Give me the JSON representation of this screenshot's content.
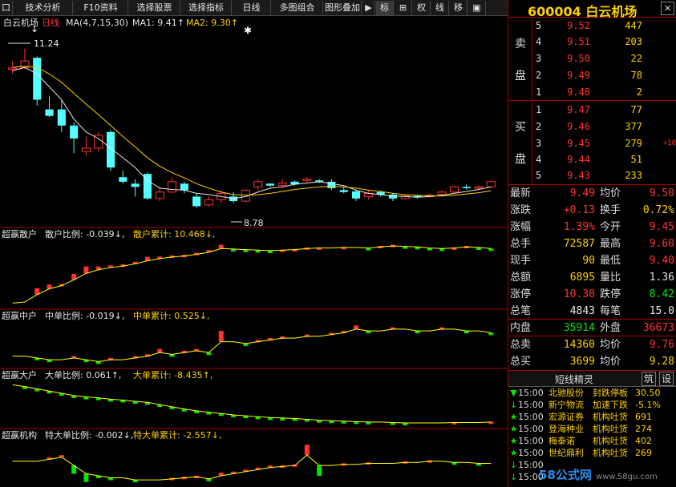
{
  "toolbar": {
    "items": [
      {
        "label": "口"
      },
      {
        "label": "技术分析"
      },
      {
        "label": "F10资料"
      },
      {
        "label": "选择股票"
      },
      {
        "label": "选择指标"
      },
      {
        "label": "日线"
      },
      {
        "label": "多图组合"
      },
      {
        "label": "图形叠加"
      },
      {
        "label": "▶"
      },
      {
        "label": "标"
      },
      {
        "label": "⊞"
      },
      {
        "label": "权"
      },
      {
        "label": "线"
      },
      {
        "label": "移"
      },
      {
        "label": "▣"
      }
    ]
  },
  "main_chart": {
    "title": "白云机场",
    "period": "日线",
    "ma_desc": "MA(4,7,15,30)",
    "ma1": "MA1: 9.41↑",
    "ma2": "MA2: 9.30↑",
    "high_mark": "11.24",
    "low_mark": "8.78"
  },
  "indicators": [
    {
      "name": "超赢散户",
      "ratio": "散户比例: -0.039↓,",
      "cum": "散户累计: 10.468↓,"
    },
    {
      "name": "超赢中户",
      "ratio": "中单比例: -0.019↓,",
      "cum": "中单累计: 0.525↓,"
    },
    {
      "name": "超赢大户",
      "ratio": "大单比例: 0.061↑,",
      "cum": "大单累计: -8.435↑,"
    },
    {
      "name": "超赢机构",
      "ratio": "特大单比例: -0.002↓,",
      "cum": "特大单累计: -2.557↓,"
    }
  ],
  "stock": {
    "code": "600004",
    "name": "白云机场",
    "close_icon": "✕"
  },
  "order_book": {
    "sell_side": [
      "卖",
      "盘"
    ],
    "buy_side": [
      "买",
      "盘"
    ],
    "sell": [
      {
        "level": "5",
        "price": "9.52",
        "vol": "447"
      },
      {
        "level": "4",
        "price": "9.51",
        "vol": "203"
      },
      {
        "level": "3",
        "price": "9.50",
        "vol": "22"
      },
      {
        "level": "2",
        "price": "9.49",
        "vol": "78"
      },
      {
        "level": "1",
        "price": "9.48",
        "vol": "2"
      }
    ],
    "buy": [
      {
        "level": "1",
        "price": "9.47",
        "vol": "77",
        "chg": ""
      },
      {
        "level": "2",
        "price": "9.46",
        "vol": "377",
        "chg": ""
      },
      {
        "level": "3",
        "price": "9.45",
        "vol": "279",
        "chg": "+10"
      },
      {
        "level": "4",
        "price": "9.44",
        "vol": "51",
        "chg": ""
      },
      {
        "level": "5",
        "price": "9.43",
        "vol": "233",
        "chg": ""
      }
    ]
  },
  "quote": [
    {
      "k1": "最新",
      "v1": "9.49",
      "c1": "red",
      "k2": "均价",
      "v2": "9.50",
      "c2": "red"
    },
    {
      "k1": "涨跌",
      "v1": "+0.13",
      "c1": "red",
      "k2": "换手",
      "v2": "0.72%",
      "c2": "yellow"
    },
    {
      "k1": "涨幅",
      "v1": "1.39%",
      "c1": "red",
      "k2": "今开",
      "v2": "9.45",
      "c2": "red"
    },
    {
      "k1": "总手",
      "v1": "72587",
      "c1": "yellow",
      "k2": "最高",
      "v2": "9.60",
      "c2": "red"
    },
    {
      "k1": "现手",
      "v1": "90",
      "c1": "yellow",
      "k2": "最低",
      "v2": "9.40",
      "c2": "red"
    },
    {
      "k1": "总额",
      "v1": "6895",
      "c1": "yellow",
      "k2": "量比",
      "v2": "1.36",
      "c2": "white"
    },
    {
      "k1": "涨停",
      "v1": "10.30",
      "c1": "red",
      "k2": "跌停",
      "v2": "8.42",
      "c2": "green"
    },
    {
      "k1": "总笔",
      "v1": "4843",
      "c1": "white",
      "k2": "每笔",
      "v2": "15.0",
      "c2": "white"
    },
    {
      "k1": "内盘",
      "v1": "35914",
      "c1": "green",
      "k2": "外盘",
      "v2": "36673",
      "c2": "red"
    },
    {
      "k1": "总卖",
      "v1": "14360",
      "c1": "yellow",
      "k2": "均价",
      "v2": "9.76",
      "c2": "red"
    },
    {
      "k1": "总买",
      "v1": "3699",
      "c1": "yellow",
      "k2": "均价",
      "v2": "9.28",
      "c2": "yellow"
    }
  ],
  "elf": {
    "title": "短线精灵",
    "btn1": "筑",
    "btn2": "设",
    "rows": [
      {
        "icon": "▼",
        "icolor": "#00e600",
        "time": "15:00",
        "name": "北驰股份",
        "event": "封跌停板",
        "value": "30.50"
      },
      {
        "icon": "↓",
        "icolor": "#00e600",
        "time": "15:00",
        "name": "新宁物流",
        "event": "加速下跌",
        "value": "-5.1%"
      },
      {
        "icon": "★",
        "icolor": "#00e600",
        "time": "15:00",
        "name": "宏源证券",
        "event": "机构吐货",
        "value": "691"
      },
      {
        "icon": "★",
        "icolor": "#00e600",
        "time": "15:00",
        "name": "登海种业",
        "event": "机构吐货",
        "value": "274"
      },
      {
        "icon": "★",
        "icolor": "#00e600",
        "time": "15:00",
        "name": "梅泰诺",
        "event": "机构吐货",
        "value": "402"
      },
      {
        "icon": "★",
        "icolor": "#00e600",
        "time": "15:00",
        "name": "世纪鼎利",
        "event": "机构吐货",
        "value": "269"
      },
      {
        "icon": "↓",
        "icolor": "#00e600",
        "time": "15:00",
        "name": "",
        "event": "",
        "value": ""
      },
      {
        "icon": "↓",
        "icolor": "#00e600",
        "time": "15:00",
        "name": "",
        "event": "",
        "value": ""
      }
    ]
  },
  "watermark": {
    "brand": "58公式网",
    "url": "www.58gu.com"
  },
  "colors": {
    "up": "#ff3232",
    "down": "#54ffff",
    "ma1": "#e6e6e6",
    "ma2": "#ffd000",
    "green": "#00e600",
    "border": "#aa0000"
  },
  "chart_data": {
    "type": "candlestick",
    "title": "白云机场 日线",
    "candles": [
      {
        "o": 10.92,
        "h": 11.05,
        "l": 10.85,
        "c": 10.94
      },
      {
        "o": 10.95,
        "h": 11.24,
        "l": 10.92,
        "c": 11.05
      },
      {
        "o": 11.1,
        "h": 11.12,
        "l": 10.36,
        "c": 10.45
      },
      {
        "o": 10.3,
        "h": 10.5,
        "l": 10.18,
        "c": 10.2
      },
      {
        "o": 10.3,
        "h": 10.45,
        "l": 9.95,
        "c": 10.05
      },
      {
        "o": 10.05,
        "h": 10.1,
        "l": 9.62,
        "c": 9.85
      },
      {
        "o": 9.65,
        "h": 9.88,
        "l": 9.58,
        "c": 9.7
      },
      {
        "o": 9.7,
        "h": 9.95,
        "l": 9.65,
        "c": 9.9
      },
      {
        "o": 9.95,
        "h": 9.98,
        "l": 9.35,
        "c": 9.4
      },
      {
        "o": 9.25,
        "h": 9.35,
        "l": 9.15,
        "c": 9.18
      },
      {
        "o": 9.15,
        "h": 9.22,
        "l": 8.95,
        "c": 9.1
      },
      {
        "o": 9.3,
        "h": 9.32,
        "l": 8.9,
        "c": 8.92
      },
      {
        "o": 8.92,
        "h": 9.1,
        "l": 8.88,
        "c": 9.02
      },
      {
        "o": 9.02,
        "h": 9.25,
        "l": 9.0,
        "c": 9.18
      },
      {
        "o": 9.15,
        "h": 9.18,
        "l": 9.0,
        "c": 9.05
      },
      {
        "o": 8.95,
        "h": 9.0,
        "l": 8.78,
        "c": 8.8
      },
      {
        "o": 8.82,
        "h": 8.95,
        "l": 8.8,
        "c": 8.9
      },
      {
        "o": 8.9,
        "h": 9.05,
        "l": 8.85,
        "c": 9.0
      },
      {
        "o": 8.95,
        "h": 9.02,
        "l": 8.85,
        "c": 8.88
      },
      {
        "o": 8.88,
        "h": 9.05,
        "l": 8.86,
        "c": 9.05
      },
      {
        "o": 9.1,
        "h": 9.22,
        "l": 9.05,
        "c": 9.18
      },
      {
        "o": 9.15,
        "h": 9.16,
        "l": 9.1,
        "c": 9.12
      },
      {
        "o": 9.12,
        "h": 9.22,
        "l": 9.08,
        "c": 9.16
      },
      {
        "o": 9.18,
        "h": 9.2,
        "l": 9.12,
        "c": 9.14
      },
      {
        "o": 9.2,
        "h": 9.25,
        "l": 9.15,
        "c": 9.22
      },
      {
        "o": 9.2,
        "h": 9.22,
        "l": 9.16,
        "c": 9.18
      },
      {
        "o": 9.18,
        "h": 9.22,
        "l": 9.05,
        "c": 9.08
      },
      {
        "o": 9.05,
        "h": 9.1,
        "l": 9.0,
        "c": 9.02
      },
      {
        "o": 9.03,
        "h": 9.06,
        "l": 8.88,
        "c": 8.92
      },
      {
        "o": 8.95,
        "h": 9.05,
        "l": 8.9,
        "c": 9.0
      },
      {
        "o": 9.02,
        "h": 9.04,
        "l": 8.95,
        "c": 8.98
      },
      {
        "o": 8.98,
        "h": 9.0,
        "l": 8.88,
        "c": 8.92
      },
      {
        "o": 8.92,
        "h": 8.98,
        "l": 8.9,
        "c": 8.96
      },
      {
        "o": 8.96,
        "h": 8.98,
        "l": 8.92,
        "c": 8.94
      },
      {
        "o": 8.95,
        "h": 9.0,
        "l": 8.93,
        "c": 8.97
      },
      {
        "o": 8.98,
        "h": 9.05,
        "l": 8.95,
        "c": 9.02
      },
      {
        "o": 9.02,
        "h": 9.12,
        "l": 9.0,
        "c": 9.1
      },
      {
        "o": 9.1,
        "h": 9.14,
        "l": 9.06,
        "c": 9.08
      },
      {
        "o": 9.08,
        "h": 9.12,
        "l": 9.05,
        "c": 9.1
      },
      {
        "o": 9.1,
        "h": 9.2,
        "l": 9.08,
        "c": 9.18
      }
    ],
    "ma1": [
      10.9,
      10.95,
      10.85,
      10.65,
      10.45,
      10.15,
      9.95,
      9.85,
      9.7,
      9.55,
      9.4,
      9.2,
      9.08,
      9.06,
      9.05,
      9.0,
      8.98,
      8.95,
      8.92,
      8.95,
      9.02,
      9.08,
      9.1,
      9.14,
      9.16,
      9.18,
      9.15,
      9.12,
      9.05,
      9.0,
      8.98,
      8.96,
      8.95,
      8.94,
      8.95,
      8.97,
      9.0,
      9.03,
      9.06,
      9.1
    ],
    "ma2": [
      10.95,
      10.97,
      10.95,
      10.85,
      10.72,
      10.55,
      10.38,
      10.22,
      10.05,
      9.88,
      9.72,
      9.55,
      9.42,
      9.32,
      9.24,
      9.15,
      9.08,
      9.02,
      8.98,
      8.97,
      8.98,
      9.0,
      9.03,
      9.06,
      9.08,
      9.1,
      9.11,
      9.1,
      9.08,
      9.05,
      9.03,
      9.0,
      8.98,
      8.97,
      8.96,
      8.96,
      8.97,
      8.99,
      9.01,
      9.04
    ],
    "indicators": [
      {
        "name": "超赢散户",
        "line": [
          0.2,
          0.4,
          1.8,
          2.9,
          3.5,
          4.6,
          5.8,
          6.5,
          6.9,
          7.2,
          7.6,
          8.2,
          8.6,
          8.9,
          9.1,
          9.4,
          9.8,
          10.5,
          10.4,
          10.3,
          10.2,
          10.1,
          10.2,
          10.3,
          10.5,
          10.6,
          10.6,
          10.7,
          10.7,
          10.6,
          10.8,
          11.0,
          10.9,
          10.8,
          10.6,
          10.5,
          10.6,
          10.8,
          10.7,
          10.5
        ],
        "bars": [
          0.0,
          0.0,
          1.2,
          0.8,
          0.3,
          1.1,
          1.3,
          0.6,
          0.4,
          0.3,
          0.4,
          0.7,
          0.4,
          0.3,
          0.2,
          0.3,
          0.4,
          0.7,
          -0.1,
          -0.1,
          -0.1,
          -0.1,
          0.1,
          0.1,
          0.2,
          0.1,
          0.0,
          0.1,
          0.0,
          -0.1,
          0.2,
          0.2,
          -0.1,
          -0.1,
          -0.2,
          -0.1,
          0.1,
          0.2,
          -0.1,
          -0.2
        ]
      },
      {
        "name": "超赢中户",
        "line": [
          -0.2,
          -0.2,
          -0.25,
          -0.3,
          -0.3,
          -0.25,
          -0.3,
          -0.35,
          -0.3,
          -0.3,
          -0.25,
          -0.2,
          -0.1,
          -0.15,
          -0.1,
          -0.05,
          -0.1,
          0.2,
          0.2,
          0.15,
          0.2,
          0.25,
          0.3,
          0.3,
          0.35,
          0.35,
          0.4,
          0.45,
          0.55,
          0.5,
          0.5,
          0.55,
          0.55,
          0.5,
          0.5,
          0.55,
          0.55,
          0.5,
          0.5,
          0.45
        ],
        "bars": [
          0.0,
          0.0,
          -0.05,
          -0.05,
          0.0,
          0.05,
          -0.05,
          -0.05,
          0.05,
          0.0,
          0.05,
          0.05,
          0.1,
          -0.05,
          0.05,
          0.05,
          -0.05,
          0.3,
          0.0,
          -0.05,
          0.05,
          0.05,
          0.05,
          0.0,
          0.05,
          0.0,
          0.05,
          0.05,
          0.1,
          -0.05,
          0.0,
          0.05,
          0.0,
          -0.05,
          0.0,
          0.05,
          0.0,
          -0.05,
          0.0,
          -0.05
        ]
      },
      {
        "name": "超赢大户",
        "line": [
          -0.1,
          -0.5,
          -1.0,
          -1.5,
          -2.0,
          -2.5,
          -2.8,
          -3.0,
          -3.3,
          -3.5,
          -3.8,
          -4.0,
          -4.5,
          -5.0,
          -5.5,
          -5.9,
          -6.2,
          -6.5,
          -6.8,
          -7.0,
          -7.2,
          -7.4,
          -7.5,
          -7.6,
          -7.8,
          -8.0,
          -8.1,
          -8.2,
          -8.3,
          -8.4,
          -8.4,
          -8.5,
          -8.6,
          -8.6,
          -8.6,
          -8.6,
          -8.5,
          -8.5,
          -8.5,
          -8.4
        ],
        "bars": [
          0.0,
          -0.4,
          -0.5,
          -0.5,
          -0.5,
          -0.5,
          -0.3,
          -0.2,
          -0.3,
          -0.2,
          -0.3,
          -0.2,
          -0.5,
          -0.5,
          -0.5,
          -0.4,
          -0.3,
          -0.3,
          -0.3,
          -0.2,
          -0.2,
          -0.2,
          -0.1,
          -0.1,
          -0.2,
          -0.2,
          -0.1,
          -0.1,
          -0.1,
          -0.1,
          0.0,
          -0.1,
          -0.1,
          0.0,
          0.0,
          0.0,
          0.1,
          0.0,
          0.0,
          0.1
        ]
      },
      {
        "name": "超赢机构",
        "line": [
          0.0,
          0.0,
          0.0,
          0.1,
          0.2,
          -0.2,
          -0.6,
          -0.7,
          -0.8,
          -0.8,
          -0.9,
          -0.9,
          -0.9,
          -0.85,
          -0.8,
          -0.75,
          -0.85,
          -0.7,
          -0.6,
          -0.5,
          -0.4,
          -0.3,
          -0.25,
          -0.2,
          0.3,
          -0.2,
          -0.2,
          -0.15,
          -0.15,
          -0.1,
          -0.1,
          -0.1,
          -0.05,
          -0.05,
          0.0,
          0.0,
          -0.05,
          -0.05,
          -0.1,
          -0.1
        ],
        "bars": [
          0.0,
          0.0,
          0.0,
          0.1,
          0.1,
          -0.4,
          -0.4,
          -0.1,
          -0.1,
          0.0,
          -0.1,
          0.0,
          0.0,
          0.05,
          0.05,
          0.05,
          -0.1,
          0.15,
          0.1,
          0.1,
          0.1,
          0.1,
          0.05,
          0.05,
          0.5,
          -0.5,
          0.0,
          0.05,
          0.0,
          0.05,
          0.0,
          0.0,
          0.05,
          0.0,
          0.05,
          0.0,
          -0.05,
          0.0,
          -0.05,
          0.0
        ]
      }
    ]
  }
}
